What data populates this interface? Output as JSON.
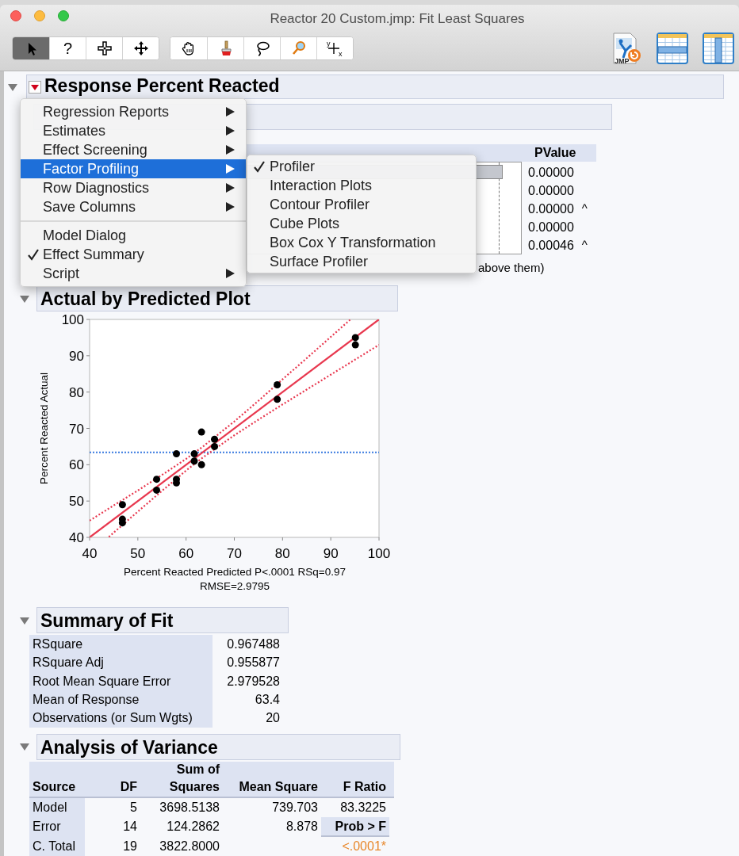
{
  "window": {
    "title": "Reactor 20 Custom.jmp: Fit Least Squares"
  },
  "toolbar": {
    "groups": [
      [
        {
          "kind": "arrow",
          "selected": true
        },
        {
          "kind": "help",
          "label": "?",
          "selected": false
        },
        {
          "kind": "scroller",
          "selected": false
        },
        {
          "kind": "move",
          "selected": false
        }
      ],
      [
        {
          "kind": "hand",
          "selected": false
        },
        {
          "kind": "brush",
          "selected": false
        },
        {
          "kind": "lasso",
          "selected": false
        },
        {
          "kind": "magnifier",
          "selected": false
        },
        {
          "kind": "crosshair",
          "labels": [
            "y",
            "x"
          ],
          "selected": false
        }
      ]
    ],
    "right_buttons": [
      {
        "kind": "jmp",
        "label": "JMP"
      },
      {
        "kind": "rows"
      },
      {
        "kind": "columns"
      }
    ]
  },
  "report": {
    "title": "Response Percent Reacted",
    "expanded": true,
    "effect_summary": {
      "columns": [
        "PValue"
      ],
      "rows": [
        {
          "pvalue": "0.00000",
          "mark": ""
        },
        {
          "pvalue": "0.00000",
          "mark": ""
        },
        {
          "pvalue": "0.00000",
          "mark": "^"
        },
        {
          "pvalue": "0.00000",
          "mark": ""
        },
        {
          "pvalue": "0.00046",
          "mark": "^"
        }
      ],
      "note": "above them)"
    },
    "actual_by_predicted": {
      "title": "Actual by Predicted Plot",
      "expanded": true,
      "chart_data": {
        "type": "scatter",
        "xlabel": "Percent Reacted Predicted P<.0001 RSq=0.97 RMSE=2.9795",
        "ylabel": "Percent Reacted Actual",
        "xlim": [
          40,
          100
        ],
        "ylim": [
          40,
          100
        ],
        "xticks": [
          40,
          50,
          60,
          70,
          80,
          90,
          100
        ],
        "yticks": [
          40,
          50,
          60,
          70,
          80,
          90,
          100
        ],
        "x": [
          46.8,
          46.8,
          46.8,
          53.9,
          53.9,
          58,
          58,
          58,
          61.7,
          61.7,
          63.2,
          63.2,
          65.9,
          65.9,
          78.9,
          78.9,
          95.1,
          95.1
        ],
        "series": [
          {
            "color": "#000000",
            "values": [
              49,
              45,
              44,
              56,
              53,
              63,
              56,
              55,
              63,
              61,
              69,
              60,
              67,
              65,
              82,
              78,
              95,
              93
            ]
          },
          {
            "color": "#e8384f",
            "type": "line",
            "x": [
              40,
              100
            ],
            "values": [
              40,
              100
            ]
          },
          {
            "color": "#e8384f",
            "type": "line",
            "line_style": "dotted",
            "x": [
              40,
              45,
              50,
              55,
              60,
              63.4,
              70,
              75,
              80,
              85,
              90,
              94
            ],
            "values": [
              44.6,
              48.8,
              52.9,
              57.2,
              61.6,
              64.9,
              71.9,
              77.6,
              83.5,
              89.3,
              95.2,
              99.9
            ]
          },
          {
            "color": "#e8384f",
            "type": "line",
            "line_style": "dotted",
            "x": [
              44,
              45,
              50,
              55,
              60,
              63.4,
              70,
              75,
              80,
              85,
              90,
              95,
              100
            ],
            "values": [
              40.1,
              41.3,
              47.1,
              52.8,
              58.4,
              61.9,
              68.1,
              72.4,
              76.6,
              80.7,
              84.8,
              88.9,
              93
            ]
          }
        ],
        "ref_lines": [
          {
            "axis": "y",
            "value": 63.4,
            "color": "#3a7be0"
          }
        ]
      }
    },
    "summary_of_fit": {
      "title": "Summary of Fit",
      "expanded": true,
      "rows": [
        {
          "label": "RSquare",
          "value": "0.967488"
        },
        {
          "label": "RSquare Adj",
          "value": "0.955877"
        },
        {
          "label": "Root Mean Square Error",
          "value": "2.979528"
        },
        {
          "label": "Mean of Response",
          "value": "63.4"
        },
        {
          "label": "Observations (or Sum Wgts)",
          "value": "20"
        }
      ]
    },
    "analysis_of_variance": {
      "title": "Analysis of Variance",
      "expanded": true,
      "columns": [
        "Source",
        "DF",
        "Sum of Squares",
        "Mean Square",
        "F Ratio"
      ],
      "rows": [
        [
          "Model",
          "5",
          "3698.5138",
          "739.703",
          "83.3225"
        ],
        [
          "Error",
          "14",
          "124.2862",
          "8.878",
          "Prob > F"
        ],
        [
          "C. Total",
          "19",
          "3822.8000",
          "",
          "<.0001*"
        ]
      ]
    }
  },
  "context_menu": {
    "sections": [
      [
        {
          "label": "Regression Reports",
          "submenu": true,
          "selected": false,
          "checked": false
        },
        {
          "label": "Estimates",
          "submenu": true,
          "selected": false,
          "checked": false
        },
        {
          "label": "Effect Screening",
          "submenu": true,
          "selected": false,
          "checked": false
        },
        {
          "label": "Factor Profiling",
          "submenu": true,
          "selected": true,
          "checked": false
        },
        {
          "label": "Row Diagnostics",
          "submenu": true,
          "selected": false,
          "checked": false
        },
        {
          "label": "Save Columns",
          "submenu": true,
          "selected": false,
          "checked": false
        }
      ],
      [
        {
          "label": "Model Dialog",
          "submenu": false,
          "selected": false,
          "checked": false
        },
        {
          "label": "Effect Summary",
          "submenu": false,
          "selected": false,
          "checked": true
        },
        {
          "label": "Script",
          "submenu": true,
          "selected": false,
          "checked": false
        }
      ]
    ]
  },
  "submenu": {
    "items": [
      {
        "label": "Profiler",
        "checked": true
      },
      {
        "label": "Interaction Plots",
        "checked": false
      },
      {
        "label": "Contour Profiler",
        "checked": false
      },
      {
        "label": "Cube Plots",
        "checked": false
      },
      {
        "label": "Box Cox Y Transformation",
        "checked": false
      },
      {
        "label": "Surface Profiler",
        "checked": false
      }
    ]
  }
}
